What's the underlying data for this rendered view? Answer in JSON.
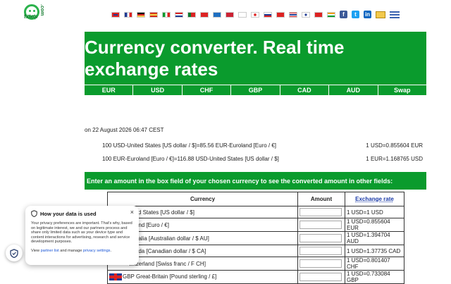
{
  "logo": {
    "text": "fxtop",
    "suffix": ".com"
  },
  "title": "Currency converter. Real time exchange rates",
  "tabs": [
    "EUR",
    "USD",
    "CHF",
    "GBP",
    "CAD",
    "AUD",
    "Swap"
  ],
  "date": "on 22 August 2026 06:47 CEST",
  "rates": [
    {
      "left": "100 USD-United States [US dollar / $]=85.56 EUR-Euroland [Euro / €]",
      "right": "1 USD=0.855604 EUR"
    },
    {
      "left": "100 EUR-Euroland [Euro / €]=116.88 USD-United States [US dollar / $]",
      "right": "1 EUR=1.168765 USD"
    }
  ],
  "instructions": "Enter an amount in the box field of your chosen currency to see the converted amount in other fields:",
  "table": {
    "headers": [
      "Currency",
      "Amount",
      "Exchange rate"
    ],
    "rows": [
      {
        "currency": "nited States [US dollar / $]",
        "rate": "1 USD=1 USD"
      },
      {
        "currency": "roland [Euro / €]",
        "rate": "1 USD=0.855604 EUR"
      },
      {
        "currency": "ustralia [Australian dollar / $ AU]",
        "rate": "1 USD=1.394704 AUD"
      },
      {
        "currency": "anada [Canadian dollar / $ CA]",
        "rate": "1 USD=1.37735 CAD"
      },
      {
        "currency": "witzerland [Swiss franc / F CH]",
        "rate": "1 USD=0.801407 CHF"
      },
      {
        "currency": "GBP Great-Britain [Pound sterling / £]",
        "rate": "1 USD=0.733084 GBP"
      }
    ]
  },
  "privacy": {
    "title": "How your data is used",
    "body": "Your privacy preferences are important. That's why, based on legitimate interest, we and our partners process and share only limited data such as your device type and content interactions for advertising, research and service development purposes.",
    "foot_prefix": "View ",
    "partner_link": "partner list",
    "foot_mid": " and manage ",
    "privacy_link": "privacy settings",
    "foot_end": "."
  },
  "colors": {
    "accent": "#0a9b2d"
  },
  "icons": [
    "shield-icon",
    "close-icon",
    "facebook-icon",
    "twitter-icon",
    "linkedin-icon",
    "mail-icon",
    "menu-icon"
  ]
}
